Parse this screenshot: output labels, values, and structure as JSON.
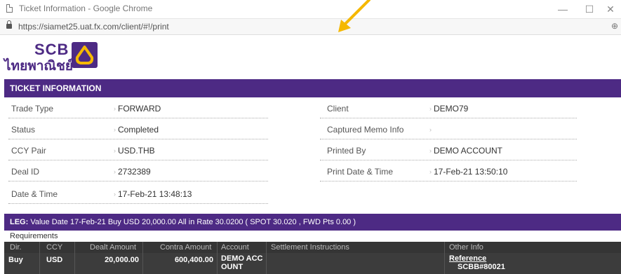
{
  "window": {
    "title": "Ticket Information - Google Chrome",
    "url": "https://siamet25.uat.fx.com/client/#!/print",
    "minimize": "—",
    "maximize": "☐",
    "close": "✕",
    "zoom_icon": "⊕"
  },
  "logo": {
    "brand": "SCB",
    "thai_name": "ไทยพาณิชย์"
  },
  "ticket": {
    "header": "TICKET INFORMATION",
    "trade_type_label": "Trade Type",
    "trade_type_value": "FORWARD",
    "client_label": "Client",
    "client_value": "DEMO79",
    "status_label": "Status",
    "status_value": "Completed",
    "memo_label": "Captured Memo Info",
    "memo_value": "",
    "ccy_pair_label": "CCY Pair",
    "ccy_pair_value": "USD.THB",
    "printed_by_label": "Printed By",
    "printed_by_value": "DEMO ACCOUNT",
    "deal_id_label": "Deal ID",
    "deal_id_value": "2732389",
    "print_dt_label": "Print Date & Time",
    "print_dt_value": "17-Feb-21 13:50:10",
    "dt_label": "Date & Time",
    "dt_value": "17-Feb-21 13:48:13"
  },
  "leg": {
    "prefix": "LEG:",
    "text": "Value Date 17-Feb-21   Buy USD 20,000.00   All in Rate 30.0200 ( SPOT 30.020 , FWD Pts 0.00 )"
  },
  "requirements": {
    "label": "Requirements",
    "columns": [
      "Dir.",
      "CCY",
      "Dealt Amount",
      "Contra Amount",
      "Account",
      "Settlement Instructions",
      "Other Info"
    ],
    "row": {
      "dir": "Buy",
      "ccy": "USD",
      "dealt": "20,000.00",
      "contra": "600,400.00",
      "account_line1": "DEMO ACC",
      "account_line2": "OUNT",
      "settlement": "",
      "ref_label": "Reference",
      "ref_value": "SCBB#80021"
    }
  },
  "colors": {
    "brand_purple": "#4d2a84",
    "annotation_arrow": "#f5b800"
  }
}
